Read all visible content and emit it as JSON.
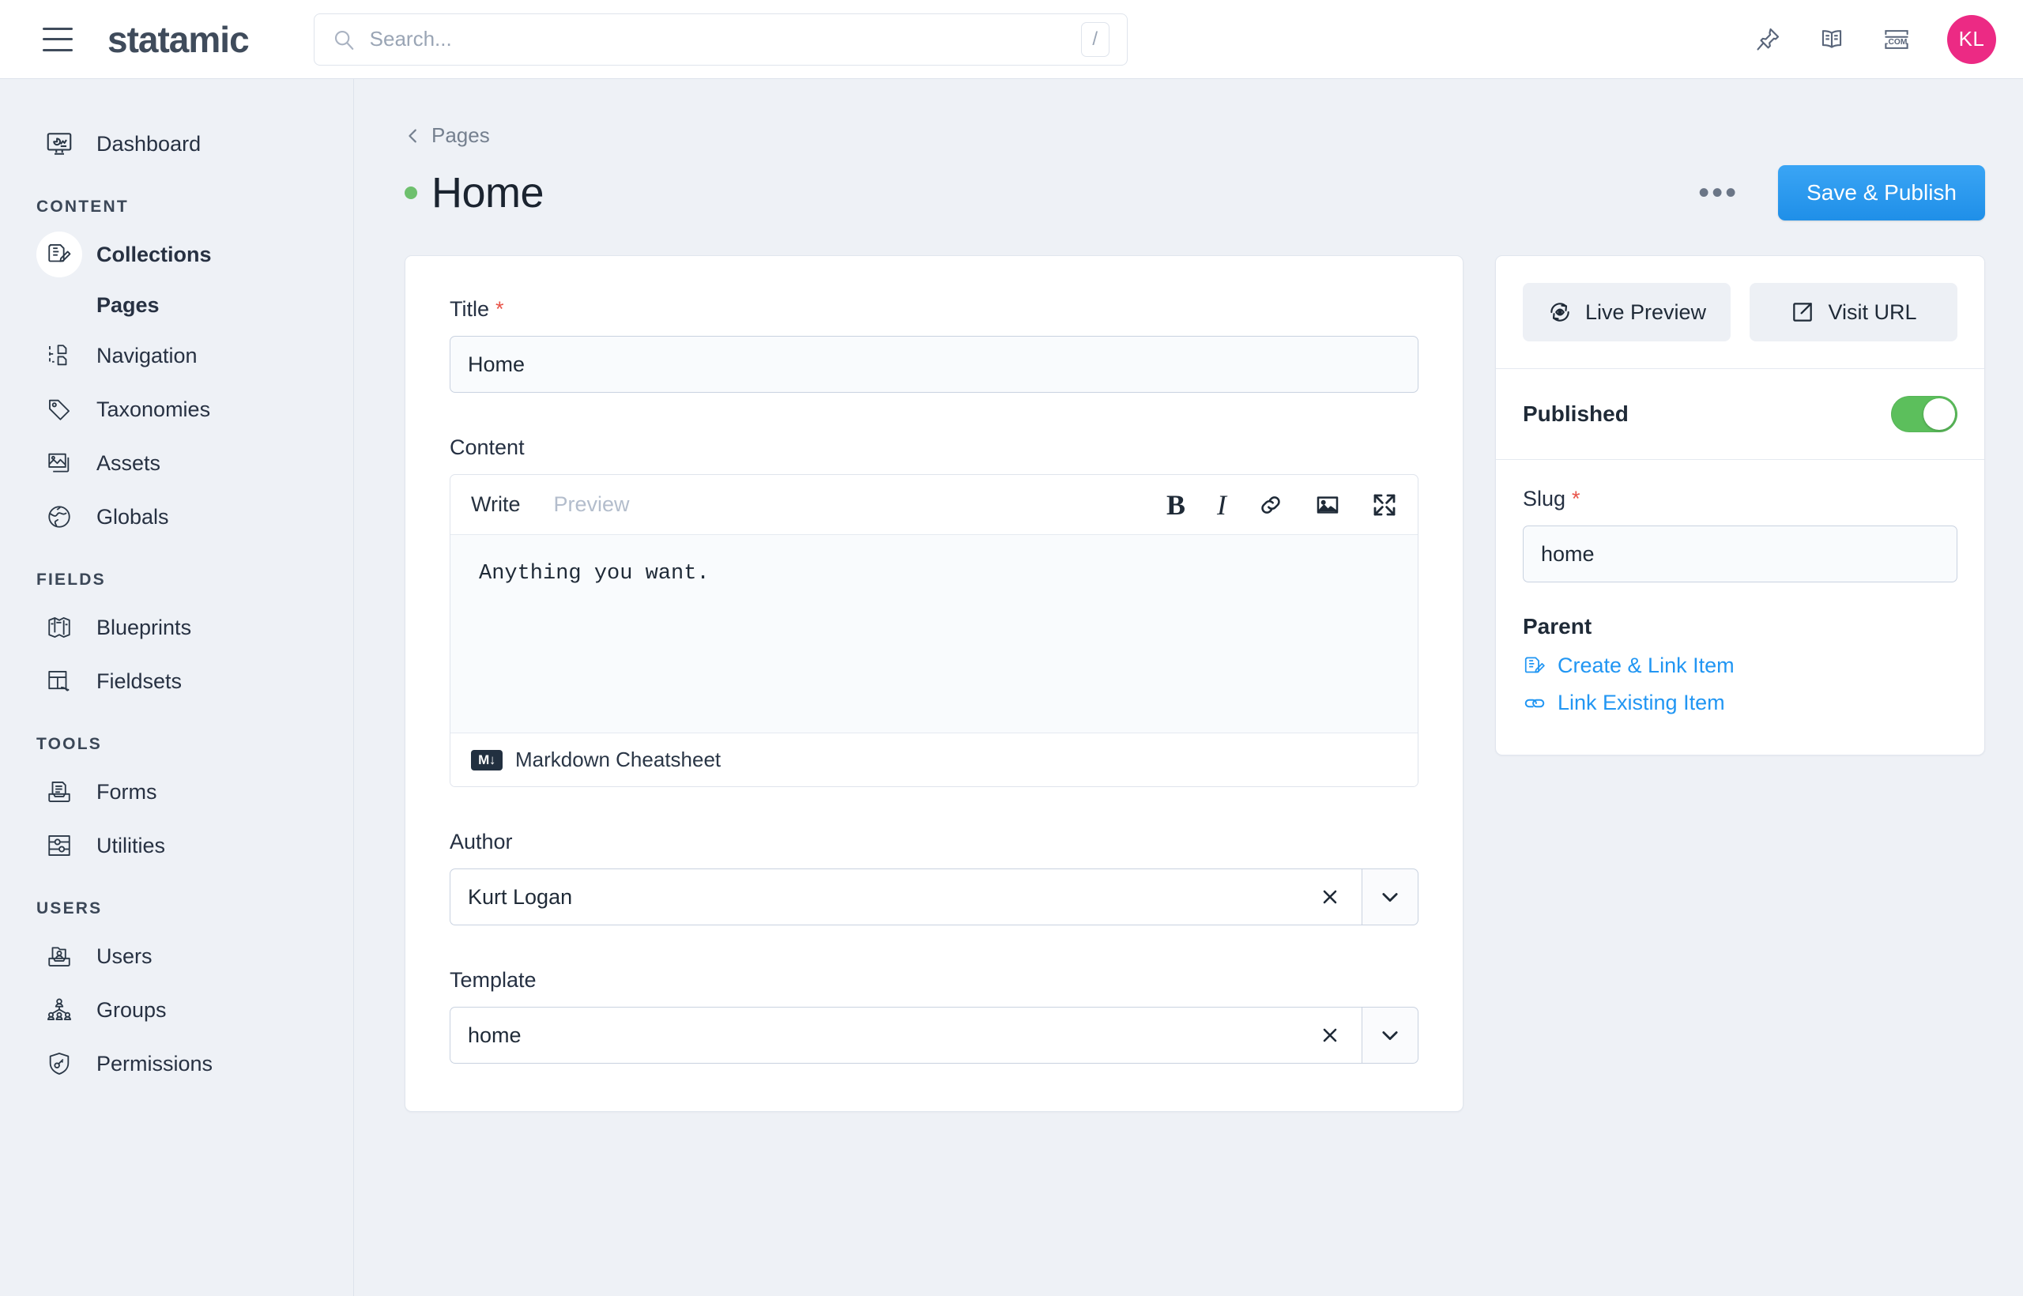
{
  "topbar": {
    "brand": "statamic",
    "menu_icon": "hamburger-icon",
    "search": {
      "placeholder": "Search...",
      "value": "",
      "shortcut": "/"
    },
    "icons": [
      "pin-icon",
      "book-icon",
      "dotcom-icon"
    ],
    "avatar_initials": "KL",
    "avatar_color": "#ec2a84"
  },
  "sidebar": {
    "items": [
      {
        "label": "Dashboard",
        "icon": "dashboard-icon",
        "active": false
      },
      {
        "label": "Collections",
        "icon": "collections-icon",
        "active": true
      },
      {
        "label": "Pages",
        "icon": "",
        "sub": true
      },
      {
        "label": "Navigation",
        "icon": "navigation-icon",
        "active": false
      },
      {
        "label": "Taxonomies",
        "icon": "tag-icon",
        "active": false
      },
      {
        "label": "Assets",
        "icon": "image-stack-icon",
        "active": false
      },
      {
        "label": "Globals",
        "icon": "globe-icon",
        "active": false
      },
      {
        "label": "Blueprints",
        "icon": "map-icon",
        "active": false
      },
      {
        "label": "Fieldsets",
        "icon": "fieldset-icon",
        "active": false
      },
      {
        "label": "Forms",
        "icon": "inbox-icon",
        "active": false
      },
      {
        "label": "Utilities",
        "icon": "sliders-icon",
        "active": false
      },
      {
        "label": "Users",
        "icon": "user-inbox-icon",
        "active": false
      },
      {
        "label": "Groups",
        "icon": "groups-icon",
        "active": false
      },
      {
        "label": "Permissions",
        "icon": "shield-key-icon",
        "active": false
      }
    ],
    "headings": {
      "content": "CONTENT",
      "fields": "FIELDS",
      "tools": "TOOLS",
      "users": "USERS"
    }
  },
  "page": {
    "breadcrumb": "Pages",
    "title": "Home",
    "status_color": "#6ec06e",
    "more_actions": "•••",
    "save_label": "Save & Publish",
    "save_color": "#2b9df4"
  },
  "form": {
    "title_field": {
      "label": "Title",
      "required": "*",
      "value": "Home"
    },
    "content_field": {
      "label": "Content",
      "tab_write": "Write",
      "tab_preview": "Preview",
      "tools": [
        "bold-icon",
        "italic-icon",
        "link-icon",
        "image-icon",
        "expand-icon"
      ],
      "body": "Anything you want.",
      "footer_label": "Markdown Cheatsheet",
      "footer_logo": "M↓"
    },
    "author_field": {
      "label": "Author",
      "value": "Kurt Logan",
      "clear": "×",
      "arrow": "⌄"
    },
    "template_field": {
      "label": "Template",
      "value": "home",
      "clear": "×",
      "arrow": "⌄"
    }
  },
  "side": {
    "live_preview": "Live Preview",
    "visit_url": "Visit URL",
    "published_label": "Published",
    "published_on": true,
    "toggle_color": "#5cbf5c",
    "slug": {
      "label": "Slug",
      "required": "*",
      "value": "home"
    },
    "parent": {
      "label": "Parent",
      "create_link": "Create & Link Item",
      "existing_link": "Link Existing Item"
    }
  }
}
